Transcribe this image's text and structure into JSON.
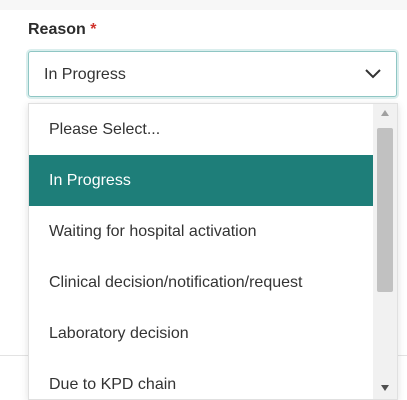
{
  "field": {
    "label": "Reason",
    "required_marker": "*",
    "selected_value": "In Progress"
  },
  "dropdown": {
    "options": [
      {
        "label": "Please Select..."
      },
      {
        "label": "In Progress"
      },
      {
        "label": "Waiting for hospital activation"
      },
      {
        "label": "Clinical decision/notification/request"
      },
      {
        "label": "Laboratory decision"
      },
      {
        "label": "Due to KPD chain"
      }
    ],
    "selected_index": 1
  },
  "icons": {
    "select_chevron": "chevron-down-icon",
    "scroll_up": "arrow-up-icon",
    "scroll_down": "arrow-down-icon"
  },
  "colors": {
    "accent": "#1e7e79",
    "required": "#d0342c",
    "focus_border": "#8fc6c4"
  }
}
